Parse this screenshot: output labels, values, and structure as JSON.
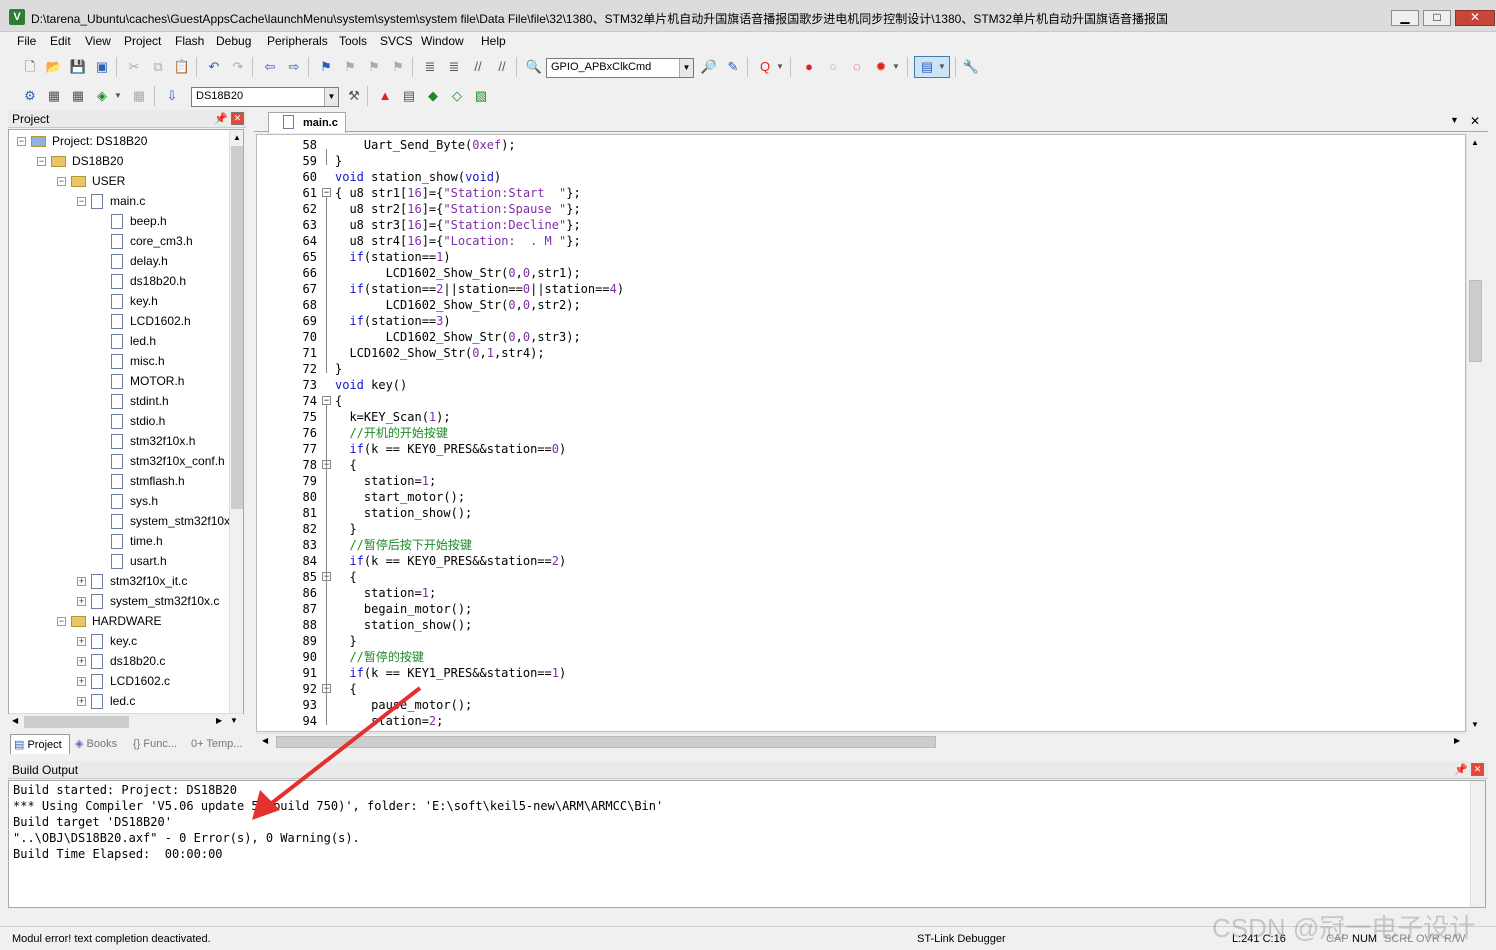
{
  "window": {
    "title": "D:\\tarena_Ubuntu\\caches\\GuestAppsCache\\launchMenu\\system\\system\\system file\\Data File\\file\\32\\1380、STM32单片机自动升国旗语音播报国歌步进电机同步控制设计\\1380、STM32单片机自动升国旗语音播报国",
    "app_icon": "keil-uvision-icon",
    "min": "▁",
    "max": "□",
    "close": "✕"
  },
  "menu": [
    "File",
    "Edit",
    "View",
    "Project",
    "Flash",
    "Debug",
    "Peripherals",
    "Tools",
    "SVCS",
    "Window",
    "Help"
  ],
  "toolbar": {
    "find_combo": "GPIO_APBxClkCmd",
    "target_combo": "DS18B20"
  },
  "project_panel": {
    "title": "Project",
    "tree": [
      {
        "label": "Project: DS18B20",
        "type": "root",
        "indent": 0,
        "toggle": "-"
      },
      {
        "label": "DS18B20",
        "type": "target",
        "indent": 1,
        "toggle": "-"
      },
      {
        "label": "USER",
        "type": "folder",
        "indent": 2,
        "toggle": "-"
      },
      {
        "label": "main.c",
        "type": "file",
        "indent": 3,
        "toggle": "-"
      },
      {
        "label": "beep.h",
        "type": "file",
        "indent": 4,
        "toggle": ""
      },
      {
        "label": "core_cm3.h",
        "type": "file",
        "indent": 4,
        "toggle": ""
      },
      {
        "label": "delay.h",
        "type": "file",
        "indent": 4,
        "toggle": ""
      },
      {
        "label": "ds18b20.h",
        "type": "file",
        "indent": 4,
        "toggle": ""
      },
      {
        "label": "key.h",
        "type": "file",
        "indent": 4,
        "toggle": ""
      },
      {
        "label": "LCD1602.h",
        "type": "file",
        "indent": 4,
        "toggle": ""
      },
      {
        "label": "led.h",
        "type": "file",
        "indent": 4,
        "toggle": ""
      },
      {
        "label": "misc.h",
        "type": "file",
        "indent": 4,
        "toggle": ""
      },
      {
        "label": "MOTOR.h",
        "type": "file",
        "indent": 4,
        "toggle": ""
      },
      {
        "label": "stdint.h",
        "type": "file",
        "indent": 4,
        "toggle": ""
      },
      {
        "label": "stdio.h",
        "type": "file",
        "indent": 4,
        "toggle": ""
      },
      {
        "label": "stm32f10x.h",
        "type": "file",
        "indent": 4,
        "toggle": ""
      },
      {
        "label": "stm32f10x_conf.h",
        "type": "file",
        "indent": 4,
        "toggle": ""
      },
      {
        "label": "stmflash.h",
        "type": "file",
        "indent": 4,
        "toggle": ""
      },
      {
        "label": "sys.h",
        "type": "file",
        "indent": 4,
        "toggle": ""
      },
      {
        "label": "system_stm32f10x",
        "type": "file",
        "indent": 4,
        "toggle": ""
      },
      {
        "label": "time.h",
        "type": "file",
        "indent": 4,
        "toggle": ""
      },
      {
        "label": "usart.h",
        "type": "file",
        "indent": 4,
        "toggle": ""
      },
      {
        "label": "stm32f10x_it.c",
        "type": "file",
        "indent": 3,
        "toggle": "+"
      },
      {
        "label": "system_stm32f10x.c",
        "type": "file",
        "indent": 3,
        "toggle": "+"
      },
      {
        "label": "HARDWARE",
        "type": "folder",
        "indent": 2,
        "toggle": "-"
      },
      {
        "label": "key.c",
        "type": "file",
        "indent": 3,
        "toggle": "+"
      },
      {
        "label": "ds18b20.c",
        "type": "file",
        "indent": 3,
        "toggle": "+"
      },
      {
        "label": "LCD1602.c",
        "type": "file",
        "indent": 3,
        "toggle": "+"
      },
      {
        "label": "led.c",
        "type": "file",
        "indent": 3,
        "toggle": "+"
      }
    ],
    "tabs": [
      "Project",
      "Books",
      "{} Func...",
      "0+ Temp..."
    ]
  },
  "editor": {
    "tab": "main.c",
    "lines": [
      {
        "n": "58",
        "code": [
          [
            "",
            "    Uart_Send_Byte("
          ],
          [
            "num",
            "0xef"
          ],
          [
            "",
            ");"
          ]
        ]
      },
      {
        "n": "59",
        "code": [
          [
            "",
            "}"
          ]
        ]
      },
      {
        "n": "60",
        "code": [
          [
            "kw",
            "void"
          ],
          [
            "",
            " station_show("
          ],
          [
            "kw",
            "void"
          ],
          [
            "",
            ")"
          ]
        ]
      },
      {
        "n": "61",
        "code": [
          [
            "",
            "{ u8 str1["
          ],
          [
            "num",
            "16"
          ],
          [
            "",
            "]={"
          ],
          [
            "str",
            "\"Station:Start  \""
          ],
          [
            "",
            "};"
          ]
        ]
      },
      {
        "n": "62",
        "code": [
          [
            "",
            "  u8 str2["
          ],
          [
            "num",
            "16"
          ],
          [
            "",
            "]={"
          ],
          [
            "str",
            "\"Station:Spause \""
          ],
          [
            "",
            "};"
          ]
        ]
      },
      {
        "n": "63",
        "code": [
          [
            "",
            "  u8 str3["
          ],
          [
            "num",
            "16"
          ],
          [
            "",
            "]={"
          ],
          [
            "str",
            "\"Station:Decline\""
          ],
          [
            "",
            "};"
          ]
        ]
      },
      {
        "n": "64",
        "code": [
          [
            "",
            "  u8 str4["
          ],
          [
            "num",
            "16"
          ],
          [
            "",
            "]={"
          ],
          [
            "str",
            "\"Location:  . M \""
          ],
          [
            "",
            "};"
          ]
        ]
      },
      {
        "n": "65",
        "code": [
          [
            "",
            "  "
          ],
          [
            "kw",
            "if"
          ],
          [
            "",
            "(station=="
          ],
          [
            "num",
            "1"
          ],
          [
            "",
            ")"
          ]
        ]
      },
      {
        "n": "66",
        "code": [
          [
            "",
            "       LCD1602_Show_Str("
          ],
          [
            "num",
            "0"
          ],
          [
            "",
            ","
          ],
          [
            "num",
            "0"
          ],
          [
            "",
            ",str1);"
          ]
        ]
      },
      {
        "n": "67",
        "code": [
          [
            "",
            "  "
          ],
          [
            "kw",
            "if"
          ],
          [
            "",
            "(station=="
          ],
          [
            "num",
            "2"
          ],
          [
            "",
            "||station=="
          ],
          [
            "num",
            "0"
          ],
          [
            "",
            "||station=="
          ],
          [
            "num",
            "4"
          ],
          [
            "",
            ")"
          ]
        ]
      },
      {
        "n": "68",
        "code": [
          [
            "",
            "       LCD1602_Show_Str("
          ],
          [
            "num",
            "0"
          ],
          [
            "",
            ","
          ],
          [
            "num",
            "0"
          ],
          [
            "",
            ",str2);"
          ]
        ]
      },
      {
        "n": "69",
        "code": [
          [
            "",
            "  "
          ],
          [
            "kw",
            "if"
          ],
          [
            "",
            "(station=="
          ],
          [
            "num",
            "3"
          ],
          [
            "",
            ")"
          ]
        ]
      },
      {
        "n": "70",
        "code": [
          [
            "",
            "       LCD1602_Show_Str("
          ],
          [
            "num",
            "0"
          ],
          [
            "",
            ","
          ],
          [
            "num",
            "0"
          ],
          [
            "",
            ",str3);"
          ]
        ]
      },
      {
        "n": "71",
        "code": [
          [
            "",
            "  LCD1602_Show_Str("
          ],
          [
            "num",
            "0"
          ],
          [
            "",
            ","
          ],
          [
            "num",
            "1"
          ],
          [
            "",
            ",str4);"
          ]
        ]
      },
      {
        "n": "72",
        "code": [
          [
            "",
            "}"
          ]
        ]
      },
      {
        "n": "73",
        "code": [
          [
            "kw",
            "void"
          ],
          [
            "",
            " key()"
          ]
        ]
      },
      {
        "n": "74",
        "code": [
          [
            "",
            "{"
          ]
        ]
      },
      {
        "n": "75",
        "code": [
          [
            "",
            "  k=KEY_Scan("
          ],
          [
            "num",
            "1"
          ],
          [
            "",
            ");"
          ]
        ]
      },
      {
        "n": "76",
        "code": [
          [
            "cmt",
            "  //开机的开始按键"
          ]
        ]
      },
      {
        "n": "77",
        "code": [
          [
            "",
            "  "
          ],
          [
            "kw",
            "if"
          ],
          [
            "",
            "(k == KEY0_PRES&&station=="
          ],
          [
            "num",
            "0"
          ],
          [
            "",
            ")"
          ]
        ]
      },
      {
        "n": "78",
        "code": [
          [
            "",
            "  {"
          ]
        ]
      },
      {
        "n": "79",
        "code": [
          [
            "",
            "    station="
          ],
          [
            "num",
            "1"
          ],
          [
            "",
            ";"
          ]
        ]
      },
      {
        "n": "80",
        "code": [
          [
            "",
            "    start_motor();"
          ]
        ]
      },
      {
        "n": "81",
        "code": [
          [
            "",
            "    station_show();"
          ]
        ]
      },
      {
        "n": "82",
        "code": [
          [
            "",
            "  }"
          ]
        ]
      },
      {
        "n": "83",
        "code": [
          [
            "cmt",
            "  //暂停后按下开始按键"
          ]
        ]
      },
      {
        "n": "84",
        "code": [
          [
            "",
            "  "
          ],
          [
            "kw",
            "if"
          ],
          [
            "",
            "(k == KEY0_PRES&&station=="
          ],
          [
            "num",
            "2"
          ],
          [
            "",
            ")"
          ]
        ]
      },
      {
        "n": "85",
        "code": [
          [
            "",
            "  {"
          ]
        ]
      },
      {
        "n": "86",
        "code": [
          [
            "",
            "    station="
          ],
          [
            "num",
            "1"
          ],
          [
            "",
            ";"
          ]
        ]
      },
      {
        "n": "87",
        "code": [
          [
            "",
            "    begain_motor();"
          ]
        ]
      },
      {
        "n": "88",
        "code": [
          [
            "",
            "    station_show();"
          ]
        ]
      },
      {
        "n": "89",
        "code": [
          [
            "",
            "  }"
          ]
        ]
      },
      {
        "n": "90",
        "code": [
          [
            "cmt",
            "  //暂停的按键"
          ]
        ]
      },
      {
        "n": "91",
        "code": [
          [
            "",
            "  "
          ],
          [
            "kw",
            "if"
          ],
          [
            "",
            "(k == KEY1_PRES&&station=="
          ],
          [
            "num",
            "1"
          ],
          [
            "",
            ")"
          ]
        ]
      },
      {
        "n": "92",
        "code": [
          [
            "",
            "  {"
          ]
        ]
      },
      {
        "n": "93",
        "code": [
          [
            "",
            "     pause_motor();"
          ]
        ]
      },
      {
        "n": "94",
        "code": [
          [
            "",
            "     station="
          ],
          [
            "num",
            "2"
          ],
          [
            "",
            ";"
          ]
        ]
      }
    ]
  },
  "build_output": {
    "title": "Build Output",
    "lines": [
      "Build started: Project: DS18B20",
      "*** Using Compiler 'V5.06 update 5 (build 750)', folder: 'E:\\soft\\keil5-new\\ARM\\ARMCC\\Bin'",
      "Build target 'DS18B20'",
      "\"..\\OBJ\\DS18B20.axf\" - 0 Error(s), 0 Warning(s).",
      "Build Time Elapsed:  00:00:00"
    ]
  },
  "status": {
    "message": "Modul error! text completion deactivated.",
    "debugger": "ST-Link Debugger",
    "position": "L:241 C:16",
    "cap": "CAP",
    "num": "NUM",
    "scrl": "SCRL",
    "ovr": "OVR",
    "rw": "R/W"
  },
  "watermark": "CSDN @冠一电子设计"
}
